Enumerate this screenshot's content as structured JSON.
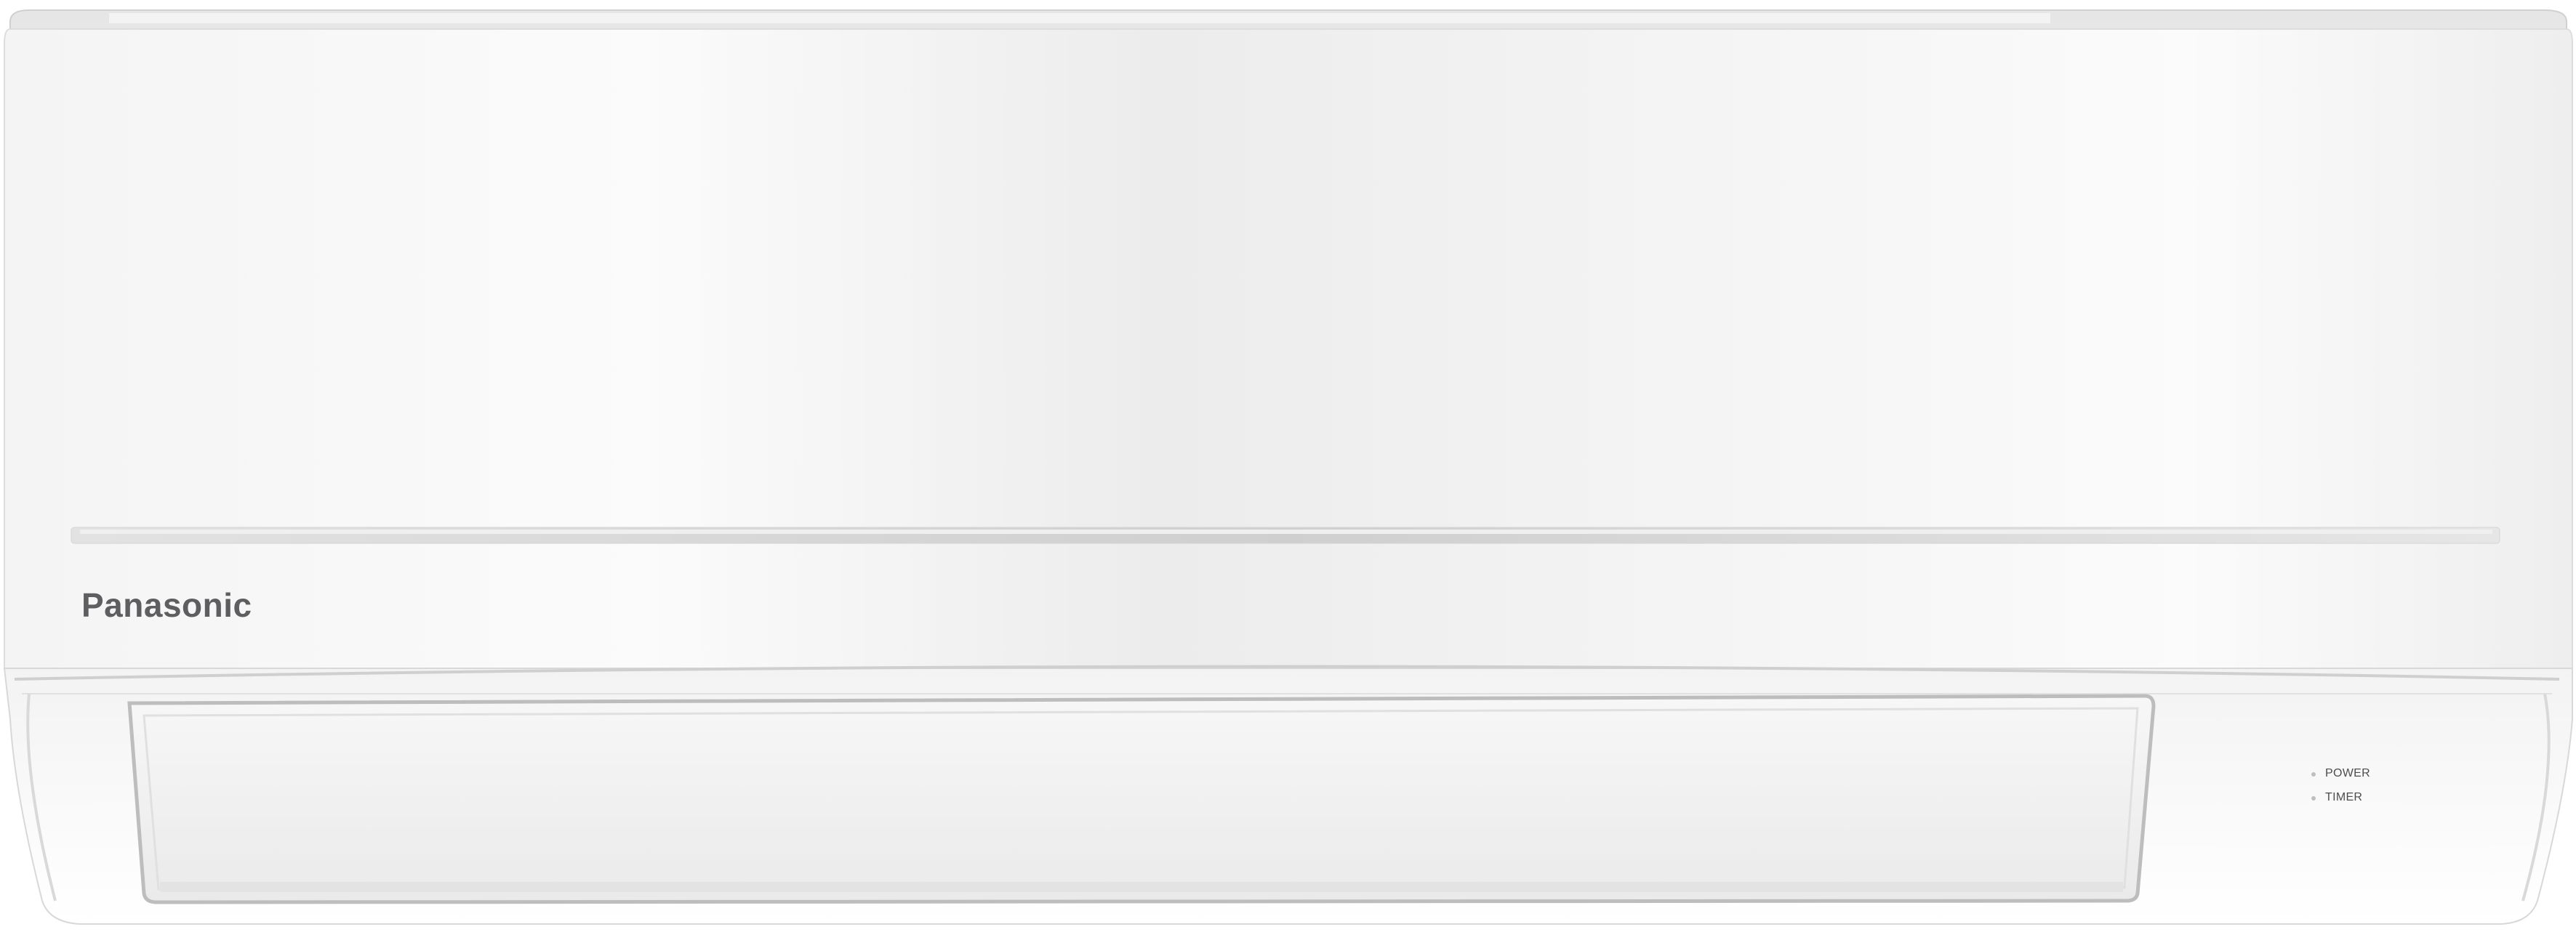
{
  "product": {
    "brand": "Panasonic",
    "indicators": [
      {
        "label": "POWER"
      },
      {
        "label": "TIMER"
      }
    ]
  },
  "colors": {
    "body": "#f2f2f2",
    "body_highlight": "#ffffff",
    "trim": "#d6d6d6",
    "logo": "#5e5e60"
  }
}
